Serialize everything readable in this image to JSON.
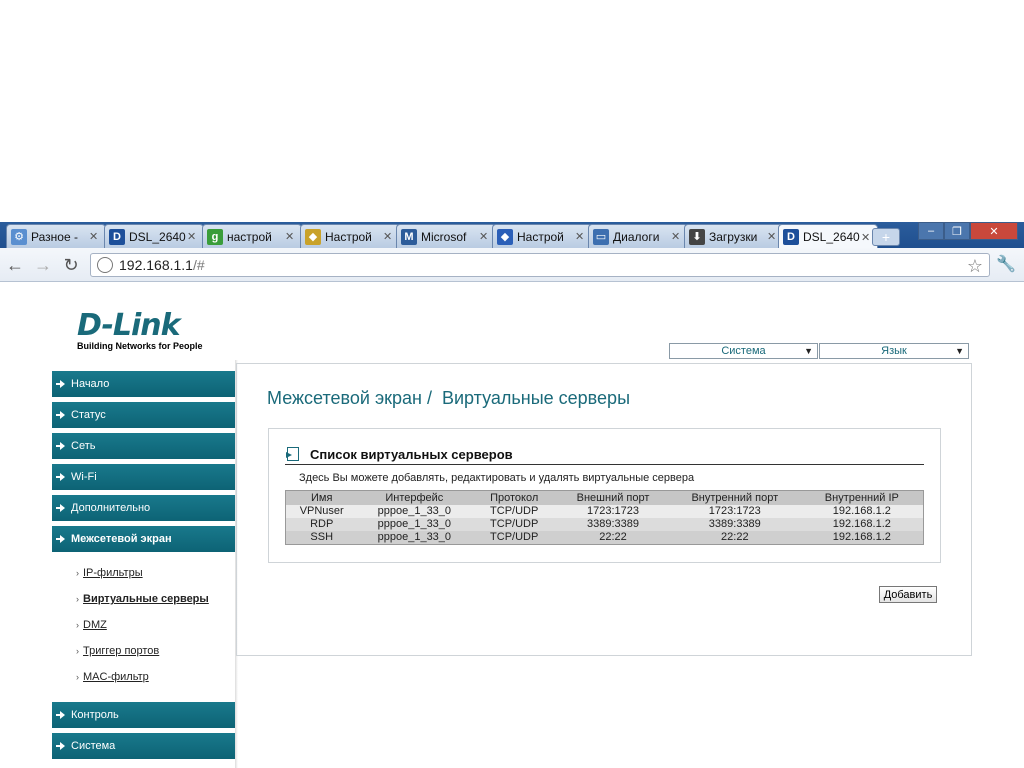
{
  "browser": {
    "tabs": [
      {
        "label": "Разное -",
        "icon": "gear-icon",
        "color": "#5a8fd0"
      },
      {
        "label": "DSL_2640",
        "icon": "dlink-icon",
        "color": "#1d4f9a"
      },
      {
        "label": "настрой",
        "icon": "google-icon",
        "color": "#3a9d3a"
      },
      {
        "label": "Настрой",
        "icon": "diamond-icon",
        "color": "#c9a22a"
      },
      {
        "label": "Microsof",
        "icon": "m-icon",
        "color": "#2d5c9a"
      },
      {
        "label": "Настрой",
        "icon": "diamond-blue-icon",
        "color": "#2b5fb8"
      },
      {
        "label": "Диалоги",
        "icon": "chat-icon",
        "color": "#3d6fb0"
      },
      {
        "label": "Загрузки",
        "icon": "download-icon",
        "color": "#444444"
      },
      {
        "label": "DSL_2640",
        "icon": "dlink-icon",
        "color": "#1d4f9a",
        "active": true
      }
    ],
    "url_host": "192.168.1.1",
    "url_path": "/#"
  },
  "header": {
    "logo_main": "D-Link",
    "logo_tagline": "Building Networks for People",
    "system_select": "Система",
    "language_select": "Язык"
  },
  "sidebar": {
    "menu_top": [
      {
        "label": "Начало"
      },
      {
        "label": "Статус"
      },
      {
        "label": "Сеть"
      },
      {
        "label": "Wi-Fi"
      },
      {
        "label": "Дополнительно"
      },
      {
        "label": "Межсетевой экран",
        "active": true
      }
    ],
    "submenu": [
      {
        "label": "IP-фильтры"
      },
      {
        "label": "Виртуальные серверы",
        "selected": true
      },
      {
        "label": "DMZ"
      },
      {
        "label": "Триггер портов"
      },
      {
        "label": "MAC-фильтр"
      }
    ],
    "menu_bottom": [
      {
        "label": "Контроль"
      },
      {
        "label": "Система"
      }
    ]
  },
  "main": {
    "title": "Межсетевой экран /  Виртуальные серверы",
    "panel_title": "Список виртуальных серверов",
    "panel_desc": "Здесь Вы можете добавлять, редактировать и удалять виртуальные сервера",
    "columns": [
      "Имя",
      "Интерфейс",
      "Протокол",
      "Внешний порт",
      "Внутренний порт",
      "Внутренний IP"
    ],
    "rows": [
      [
        "VPNuser",
        "pppoe_1_33_0",
        "TCP/UDP",
        "1723:1723",
        "1723:1723",
        "192.168.1.2"
      ],
      [
        "RDP",
        "pppoe_1_33_0",
        "TCP/UDP",
        "3389:3389",
        "3389:3389",
        "192.168.1.2"
      ],
      [
        "SSH",
        "pppoe_1_33_0",
        "TCP/UDP",
        "22:22",
        "22:22",
        "192.168.1.2"
      ]
    ],
    "add_button": "Добавить"
  }
}
